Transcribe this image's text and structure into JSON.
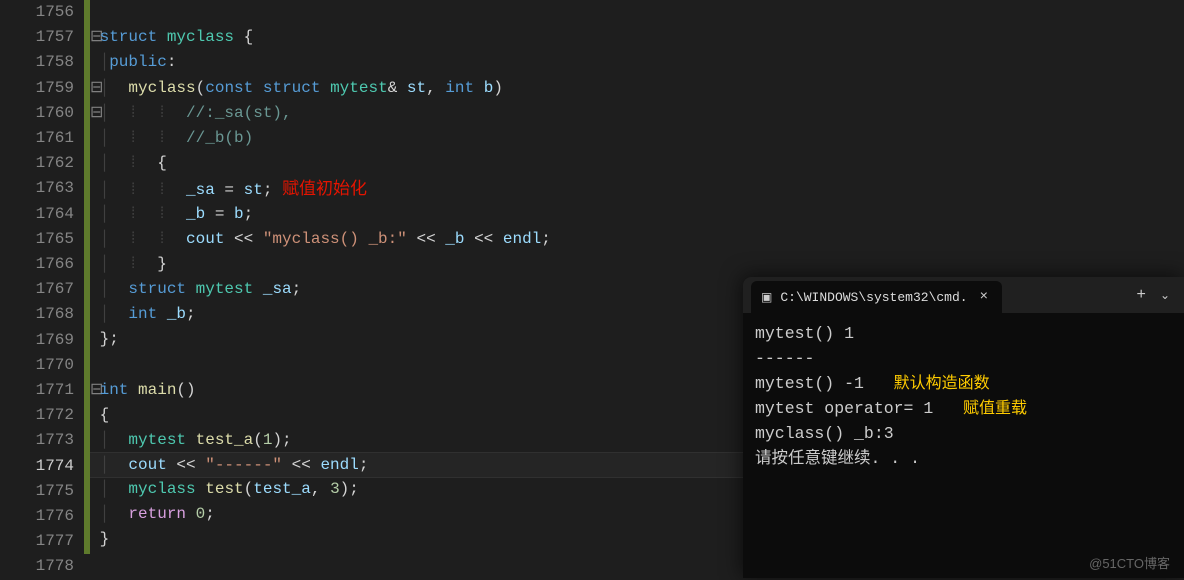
{
  "editor": {
    "lines": [
      {
        "num": "1756",
        "mod": true,
        "indent": ""
      },
      {
        "num": "1757",
        "mod": true,
        "fold": "⊟",
        "tokens": [
          [
            "kw",
            "struct"
          ],
          [
            "op",
            " "
          ],
          [
            "cls",
            "myclass"
          ],
          [
            "op",
            " {"
          ]
        ]
      },
      {
        "num": "1758",
        "mod": true,
        "indent": "|",
        "tokens": [
          [
            "kw",
            "public"
          ],
          [
            "op",
            ":"
          ]
        ]
      },
      {
        "num": "1759",
        "mod": true,
        "fold": "⊟",
        "indent": "|  ",
        "tokens": [
          [
            "fn",
            "myclass"
          ],
          [
            "op",
            "("
          ],
          [
            "kw",
            "const"
          ],
          [
            "op",
            " "
          ],
          [
            "kw",
            "struct"
          ],
          [
            "op",
            " "
          ],
          [
            "cls",
            "mytest"
          ],
          [
            "op",
            "& "
          ],
          [
            "var",
            "st"
          ],
          [
            "op",
            ", "
          ],
          [
            "kw",
            "int"
          ],
          [
            "op",
            " "
          ],
          [
            "var",
            "b"
          ],
          [
            "op",
            ")"
          ]
        ]
      },
      {
        "num": "1760",
        "mod": true,
        "fold": "⊟",
        "indent": "|  ⁞  ⁞  ",
        "tokens": [
          [
            "cmt",
            "//:_sa(st),"
          ]
        ]
      },
      {
        "num": "1761",
        "mod": true,
        "indent": "|  ⁞  ⁞  ",
        "tokens": [
          [
            "cmt",
            "//_b(b)"
          ]
        ]
      },
      {
        "num": "1762",
        "mod": true,
        "indent": "|  ⁞  ",
        "tokens": [
          [
            "op",
            "{"
          ]
        ]
      },
      {
        "num": "1763",
        "mod": true,
        "indent": "|  ⁞  ⁞  ",
        "tokens": [
          [
            "var",
            "_sa"
          ],
          [
            "op",
            " = "
          ],
          [
            "var",
            "st"
          ],
          [
            "op",
            ";"
          ]
        ],
        "annot_red": "赋值初始化"
      },
      {
        "num": "1764",
        "mod": true,
        "indent": "|  ⁞  ⁞  ",
        "tokens": [
          [
            "var",
            "_b"
          ],
          [
            "op",
            " = "
          ],
          [
            "var",
            "b"
          ],
          [
            "op",
            ";"
          ]
        ]
      },
      {
        "num": "1765",
        "mod": true,
        "indent": "|  ⁞  ⁞  ",
        "tokens": [
          [
            "var",
            "cout"
          ],
          [
            "op",
            " << "
          ],
          [
            "str",
            "\"myclass() _b:\""
          ],
          [
            "op",
            " << "
          ],
          [
            "var",
            "_b"
          ],
          [
            "op",
            " << "
          ],
          [
            "var",
            "endl"
          ],
          [
            "op",
            ";"
          ]
        ]
      },
      {
        "num": "1766",
        "mod": true,
        "indent": "|  ⁞  ",
        "tokens": [
          [
            "op",
            "}"
          ]
        ]
      },
      {
        "num": "1767",
        "mod": true,
        "indent": "|  ",
        "tokens": [
          [
            "kw",
            "struct"
          ],
          [
            "op",
            " "
          ],
          [
            "cls",
            "mytest"
          ],
          [
            "op",
            " "
          ],
          [
            "var",
            "_sa"
          ],
          [
            "op",
            ";"
          ]
        ]
      },
      {
        "num": "1768",
        "mod": true,
        "indent": "|  ",
        "tokens": [
          [
            "kw",
            "int"
          ],
          [
            "op",
            " "
          ],
          [
            "var",
            "_b"
          ],
          [
            "op",
            ";"
          ]
        ]
      },
      {
        "num": "1769",
        "mod": true,
        "indent": "",
        "tokens": [
          [
            "op",
            "};"
          ]
        ]
      },
      {
        "num": "1770",
        "mod": true,
        "indent": ""
      },
      {
        "num": "1771",
        "mod": true,
        "fold": "⊟",
        "tokens": [
          [
            "kw",
            "int"
          ],
          [
            "op",
            " "
          ],
          [
            "fn",
            "main"
          ],
          [
            "op",
            "()"
          ]
        ]
      },
      {
        "num": "1772",
        "mod": true,
        "indent": "",
        "tokens": [
          [
            "op",
            "{"
          ]
        ]
      },
      {
        "num": "1773",
        "mod": true,
        "indent": "|  ",
        "tokens": [
          [
            "cls",
            "mytest"
          ],
          [
            "op",
            " "
          ],
          [
            "fn",
            "test_a"
          ],
          [
            "op",
            "("
          ],
          [
            "num",
            "1"
          ],
          [
            "op",
            ");"
          ]
        ]
      },
      {
        "num": "1774",
        "mod": true,
        "current": true,
        "indent": "|  ",
        "tokens": [
          [
            "var",
            "cout"
          ],
          [
            "op",
            " << "
          ],
          [
            "str",
            "\"------\""
          ],
          [
            "op",
            " << "
          ],
          [
            "var",
            "endl"
          ],
          [
            "op",
            ";"
          ]
        ]
      },
      {
        "num": "1775",
        "mod": true,
        "indent": "|  ",
        "tokens": [
          [
            "cls",
            "myclass"
          ],
          [
            "op",
            " "
          ],
          [
            "fn",
            "test"
          ],
          [
            "op",
            "("
          ],
          [
            "var",
            "test_a"
          ],
          [
            "op",
            ", "
          ],
          [
            "num",
            "3"
          ],
          [
            "op",
            ");"
          ]
        ]
      },
      {
        "num": "1776",
        "mod": true,
        "indent": "|  ",
        "tokens": [
          [
            "flow",
            "return"
          ],
          [
            "op",
            " "
          ],
          [
            "num",
            "0"
          ],
          [
            "op",
            ";"
          ]
        ]
      },
      {
        "num": "1777",
        "mod": true,
        "indent": "",
        "tokens": [
          [
            "op",
            "}"
          ]
        ]
      },
      {
        "num": "1778",
        "mod": false
      }
    ]
  },
  "terminal": {
    "title": "C:\\WINDOWS\\system32\\cmd.",
    "output": [
      {
        "text": "mytest() 1"
      },
      {
        "text": "------"
      },
      {
        "text": "mytest() -1",
        "annot": "默认构造函数"
      },
      {
        "text": "mytest operator= 1",
        "annot": "赋值重载"
      },
      {
        "text": "myclass() _b:3"
      },
      {
        "text": "请按任意键继续. . ."
      }
    ]
  },
  "watermark": "@51CTO博客"
}
